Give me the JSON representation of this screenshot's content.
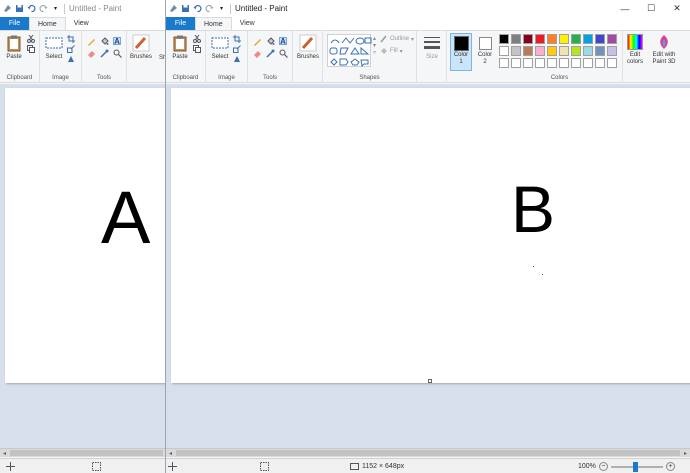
{
  "windowA": {
    "title": "Untitled - Paint",
    "tabs": {
      "file": "File",
      "home": "Home",
      "view": "View"
    },
    "groups": {
      "clipboard": "Clipboard",
      "image": "Image",
      "tools": "Tools"
    },
    "buttons": {
      "paste": "Paste",
      "select": "Select",
      "brushes": "Brushes",
      "shapes_partial": "Sh"
    },
    "canvas_letter": "A"
  },
  "windowB": {
    "title": "Untitled - Paint",
    "tabs": {
      "file": "File",
      "home": "Home",
      "view": "View"
    },
    "groups": {
      "clipboard": "Clipboard",
      "image": "Image",
      "tools": "Tools",
      "shapes": "Shapes",
      "colors": "Colors"
    },
    "buttons": {
      "paste": "Paste",
      "select": "Select",
      "brushes": "Brushes",
      "outline": "Outline",
      "fill": "Fill",
      "size": "Size",
      "color1": "Color\n1",
      "color2": "Color\n2",
      "edit_colors": "Edit\ncolors",
      "edit_paint3d": "Edit with\nPaint 3D"
    },
    "canvas_letter": "B",
    "status": {
      "dimensions": "1152 × 648px",
      "zoom": "100%"
    },
    "window_controls": {
      "minimize": "—",
      "maximize": "☐",
      "close": "✕"
    }
  },
  "palette": [
    "#000000",
    "#7f7f7f",
    "#880015",
    "#ed1c24",
    "#ff7f27",
    "#fff200",
    "#22b14c",
    "#00a2e8",
    "#3f48cc",
    "#a349a4",
    "#ffffff",
    "#c3c3c3",
    "#b97a57",
    "#ffaec9",
    "#ffc90e",
    "#efe4b0",
    "#b5e61d",
    "#99d9ea",
    "#7092be",
    "#c8bfe7",
    "#ffffff",
    "#ffffff",
    "#ffffff",
    "#ffffff",
    "#ffffff",
    "#ffffff",
    "#ffffff",
    "#ffffff",
    "#ffffff",
    "#ffffff"
  ],
  "colors": {
    "accent": "#1979ca",
    "color1": "#000000",
    "color2": "#ffffff"
  }
}
